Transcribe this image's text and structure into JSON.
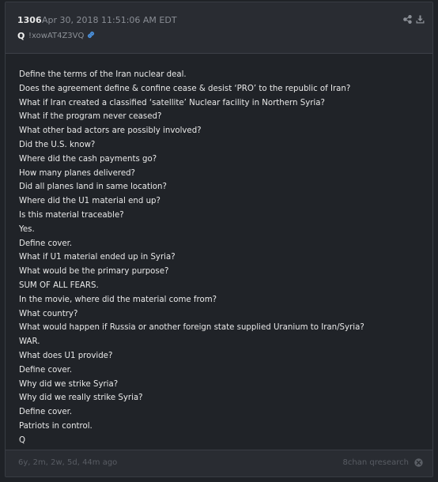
{
  "post": {
    "number": "1306",
    "date": "Apr 30, 2018 11:51:06 AM EDT",
    "author": "Q",
    "tripcode": "!xowAT4Z3VQ"
  },
  "body": {
    "lines": [
      "Define the terms of the Iran nuclear deal.",
      "Does the agreement define & confine cease & desist ‘PRO’ to the republic of Iran?",
      "What if Iran created a classified ‘satellite’ Nuclear facility in Northern Syria?",
      "What if the program never ceased?",
      "What other bad actors are possibly involved?",
      "Did the U.S. know?",
      "Where did the cash payments go?",
      "How many planes delivered?",
      "Did all planes land in same location?",
      "Where did the U1 material end up?",
      "Is this material traceable?",
      "Yes.",
      "Define cover.",
      "What if U1 material ended up in Syria?",
      "What would be the primary purpose?",
      "SUM OF ALL FEARS.",
      "In the movie, where did the material come from?",
      "What country?",
      "What would happen if Russia or another foreign state supplied Uranium to Iran/Syria?",
      "WAR.",
      "What does U1 provide?",
      "Define cover.",
      "Why did we strike Syria?",
      "Why did we really strike Syria?",
      "Define cover.",
      "Patriots in control.",
      "Q"
    ]
  },
  "footer": {
    "age": "6y, 2m, 2w, 5d, 44m ago",
    "source": "8chan qresearch"
  },
  "icons": {
    "link": "link-icon",
    "share": "share-icon",
    "download": "download-icon",
    "close": "close-circle-icon"
  },
  "colors": {
    "background": "#1f2227",
    "header": "#292c32",
    "link_accent": "#4a8fd9",
    "muted_text": "#585c63"
  }
}
